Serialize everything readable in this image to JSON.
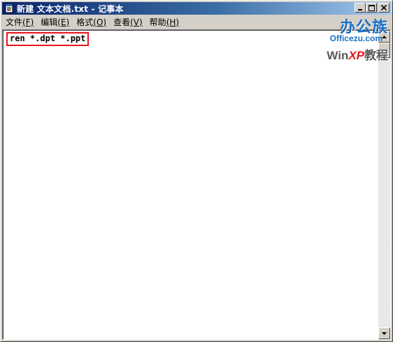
{
  "window": {
    "title": "新建 文本文档.txt - 记事本"
  },
  "menu": [
    {
      "label": "文件",
      "accel": "(F)"
    },
    {
      "label": "编辑",
      "accel": "(E)"
    },
    {
      "label": "格式",
      "accel": "(O)"
    },
    {
      "label": "查看",
      "accel": "(V)"
    },
    {
      "label": "帮助",
      "accel": "(H)"
    }
  ],
  "editor": {
    "content": "ren *.dpt *.ppt"
  },
  "watermark": {
    "brand_cn": "办公族",
    "brand_en": "Officezu.com",
    "win": "Win",
    "xp": "XP",
    "tutorial": "教程"
  },
  "colors": {
    "title_start": "#0a246a",
    "title_end": "#a6caf0",
    "highlight_border": "#e8141c",
    "brand_blue": "#1a6fc4"
  },
  "icons": {
    "app": "notepad-icon",
    "minimize": "minimize-icon",
    "maximize": "maximize-icon",
    "close": "close-icon",
    "scroll_up": "arrow-up-icon",
    "scroll_down": "arrow-down-icon"
  }
}
